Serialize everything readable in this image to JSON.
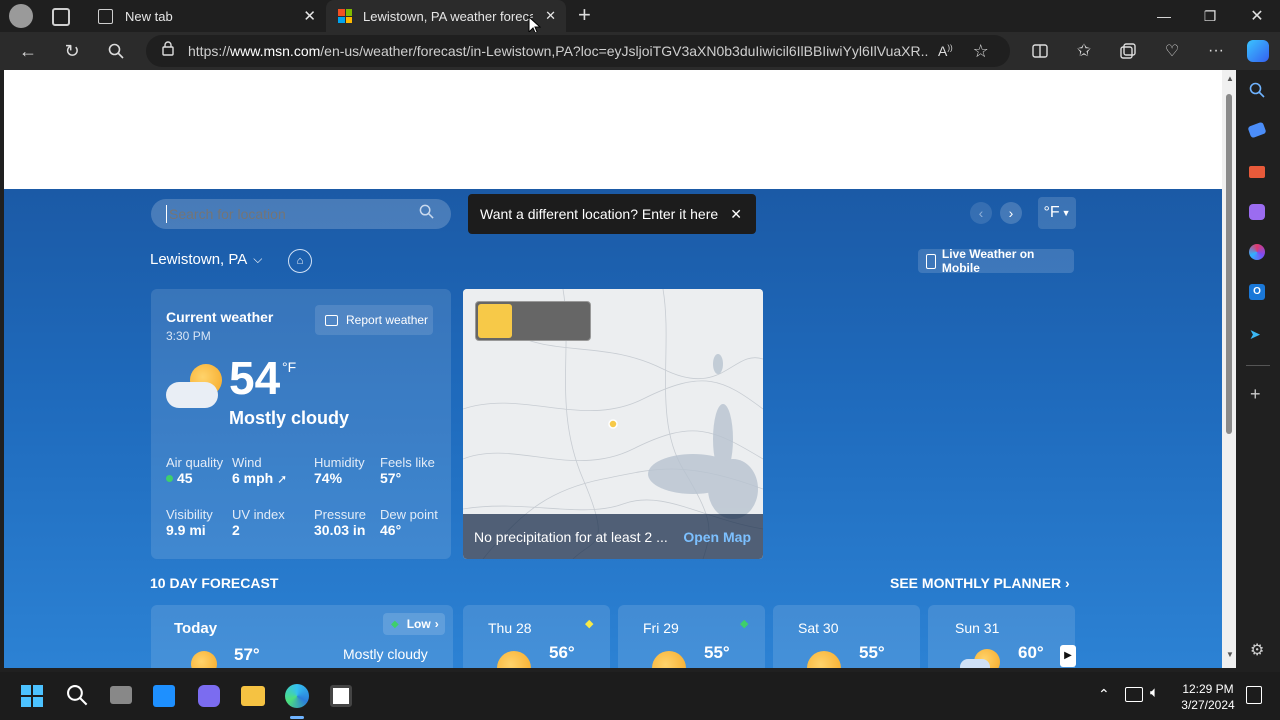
{
  "browser": {
    "tabs": [
      {
        "label": "New tab"
      },
      {
        "label": "Lewistown, PA weather forecast |"
      }
    ],
    "url_prefix": "https://",
    "url_domain": "www.msn.com",
    "url_rest": "/en-us/weather/forecast/in-Lewistown,PA?loc=eyJsljoiTGV3aXN0b3duIiwicil6IlBBIiwiYyl6IlVuaXR..."
  },
  "search": {
    "placeholder": "Search for location",
    "tooltip": "Want a different location? Enter it here"
  },
  "unit_toggle": "°F",
  "location": {
    "name": "Lewistown, PA",
    "mobile_link": "Live Weather on Mobile"
  },
  "current": {
    "heading": "Current weather",
    "time": "3:30 PM",
    "report_button": "Report weather",
    "temp": "54",
    "unit": "°F",
    "condition": "Mostly cloudy",
    "details": [
      {
        "label": "Air quality",
        "value": "45"
      },
      {
        "label": "Wind",
        "value": "6 mph"
      },
      {
        "label": "Humidity",
        "value": "74%"
      },
      {
        "label": "Feels like",
        "value": "57°"
      },
      {
        "label": "Visibility",
        "value": "9.9 mi"
      },
      {
        "label": "UV index",
        "value": "2"
      },
      {
        "label": "Pressure",
        "value": "30.03 in"
      },
      {
        "label": "Dew point",
        "value": "46°"
      }
    ]
  },
  "map": {
    "message": "No precipitation for at least 2 ...",
    "link": "Open Map"
  },
  "forecast": {
    "title": "10 DAY FORECAST",
    "planner": "SEE MONTHLY PLANNER",
    "today": {
      "day": "Today",
      "badge": "Low",
      "temp": "57°",
      "condition": "Mostly cloudy"
    },
    "days": [
      {
        "day": "Thu 28",
        "temp": "56°"
      },
      {
        "day": "Fri 29",
        "temp": "55°"
      },
      {
        "day": "Sat 30",
        "temp": "55°"
      },
      {
        "day": "Sun 31",
        "temp": "60°"
      }
    ]
  },
  "taskbar": {
    "time": "12:29 PM",
    "date": "3/27/2024"
  },
  "colors": {
    "accent": "#1f6bbd",
    "aqi_good": "#3ecf6b"
  }
}
